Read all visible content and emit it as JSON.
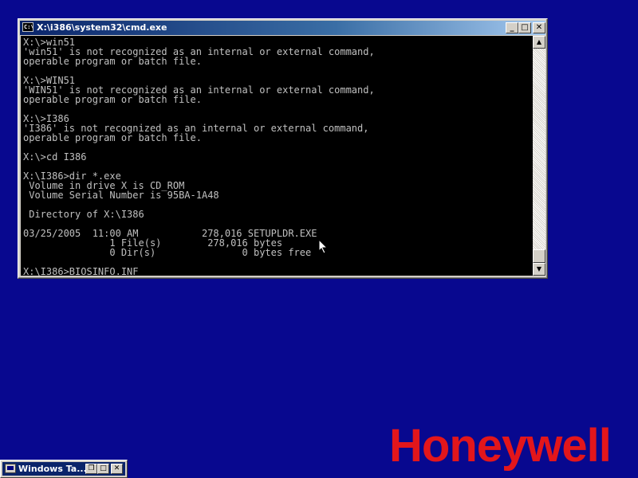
{
  "window": {
    "title": "X:\\i386\\system32\\cmd.exe",
    "icon_label": "C:\\",
    "buttons": {
      "minimize": "_",
      "maximize": "□",
      "close": "✕"
    }
  },
  "console": {
    "lines": [
      "X:\\>win51",
      "'win51' is not recognized as an internal or external command,",
      "operable program or batch file.",
      "",
      "X:\\>WIN51",
      "'WIN51' is not recognized as an internal or external command,",
      "operable program or batch file.",
      "",
      "X:\\>I386",
      "'I386' is not recognized as an internal or external command,",
      "operable program or batch file.",
      "",
      "X:\\>cd I386",
      "",
      "X:\\I386>dir *.exe",
      " Volume in drive X is CD_ROM",
      " Volume Serial Number is 95BA-1A48",
      "",
      " Directory of X:\\I386",
      "",
      "03/25/2005  11:00 AM           278,016 SETUPLDR.EXE",
      "               1 File(s)        278,016 bytes",
      "               0 Dir(s)               0 bytes free",
      "",
      "X:\\I386>BIOSINFO.INF"
    ]
  },
  "scrollbar": {
    "up_arrow": "▲",
    "down_arrow": "▼"
  },
  "logo": {
    "text": "Honeywell",
    "color": "#e3161b"
  },
  "minimized_window": {
    "title": "Windows Ta...",
    "buttons": {
      "restore": "❐",
      "maximize": "□",
      "close": "✕"
    }
  },
  "colors": {
    "desktop": "#08088f",
    "titlebar": "#0a246a",
    "console_bg": "#000000",
    "console_text": "#c0c0c0"
  }
}
